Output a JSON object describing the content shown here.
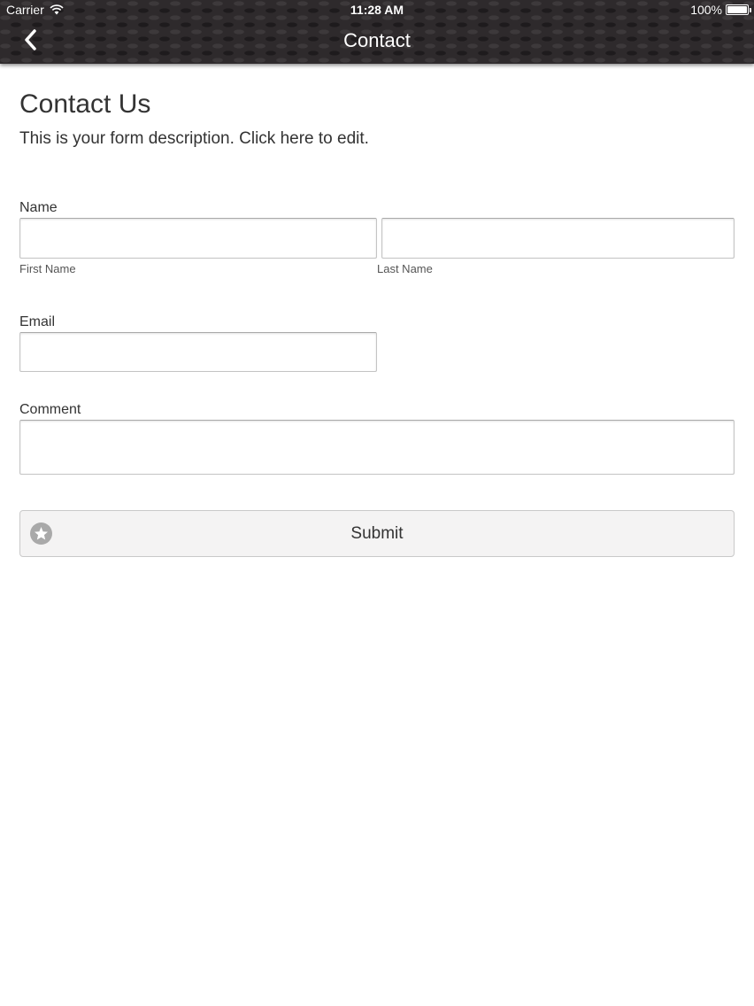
{
  "status_bar": {
    "carrier": "Carrier",
    "time": "11:28 AM",
    "battery": "100%"
  },
  "nav": {
    "title": "Contact",
    "back_icon": "chevron-left-icon"
  },
  "form": {
    "title": "Contact Us",
    "description": "This is your form description. Click here to edit.",
    "name": {
      "label": "Name",
      "first_sublabel": "First Name",
      "last_sublabel": "Last Name",
      "first_value": "",
      "last_value": ""
    },
    "email": {
      "label": "Email",
      "value": ""
    },
    "comment": {
      "label": "Comment",
      "value": ""
    },
    "submit": {
      "label": "Submit",
      "icon": "star-icon"
    }
  },
  "colors": {
    "topbar": "#2e2a2c",
    "button_bg": "#f4f3f3",
    "icon_gray": "#a9a9a9"
  }
}
